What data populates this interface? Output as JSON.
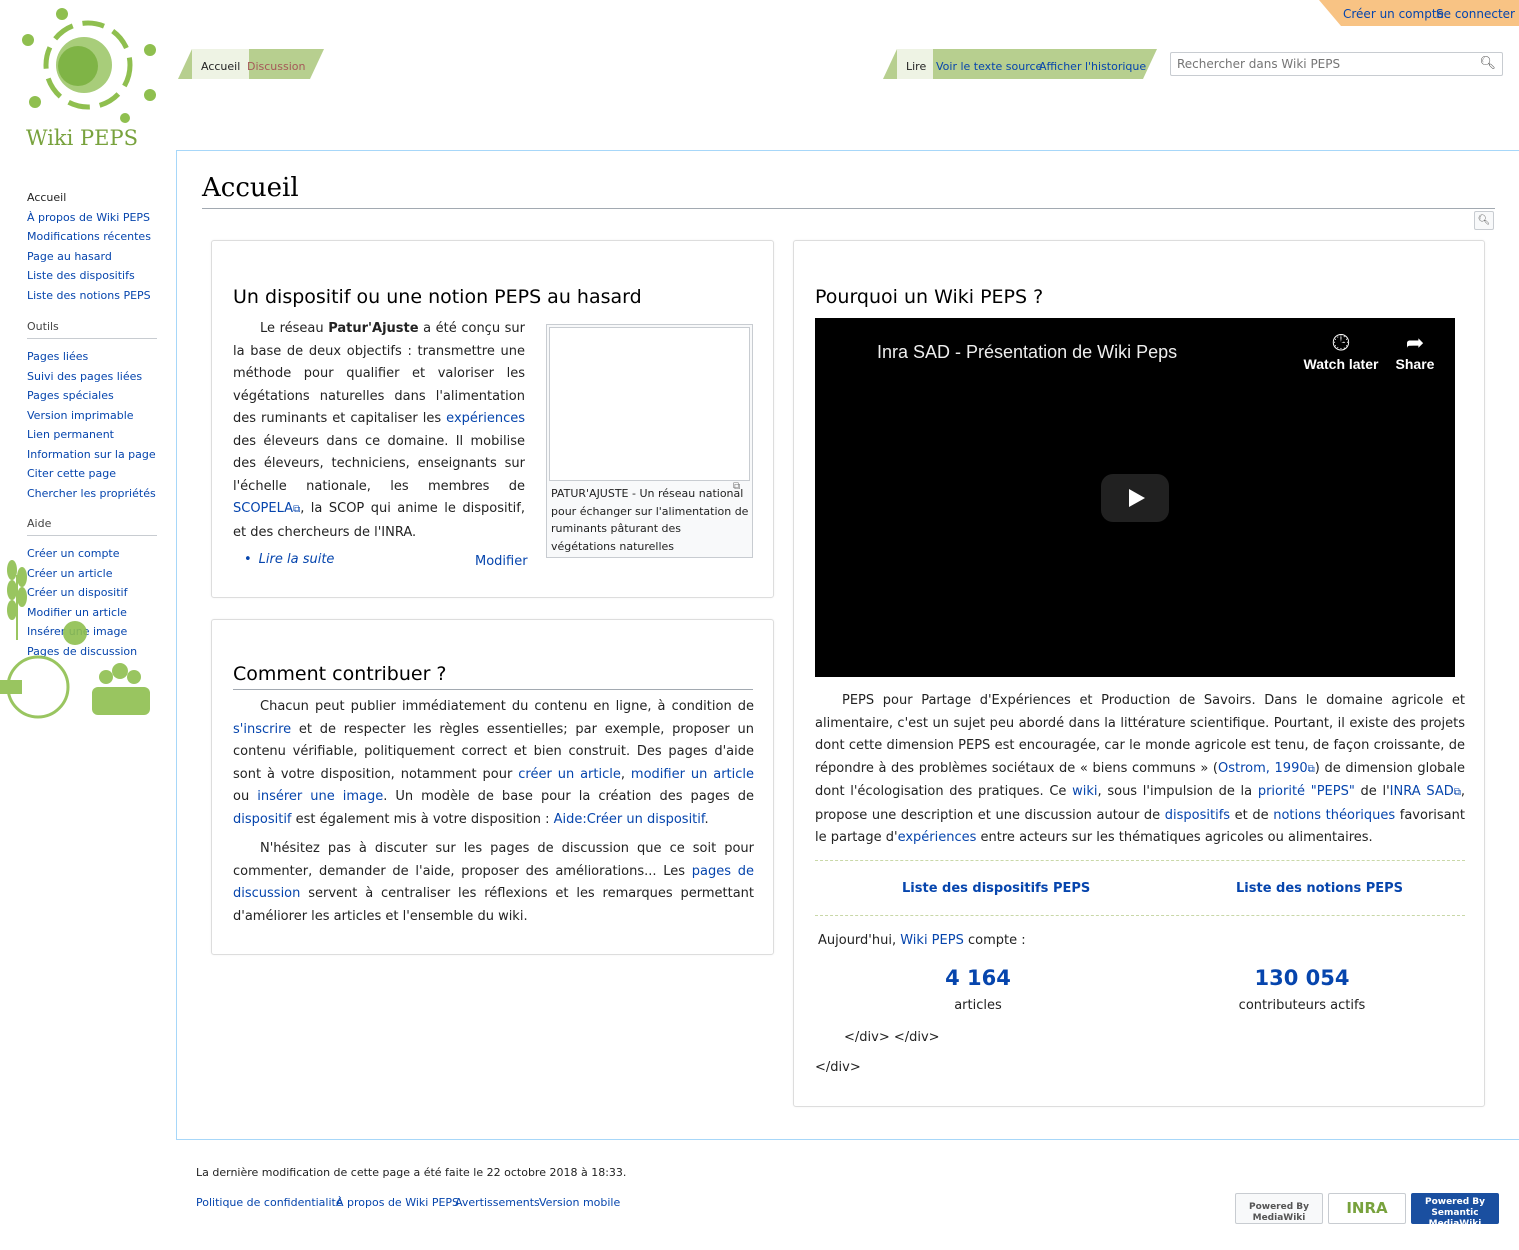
{
  "personal": {
    "create_account": "Créer un compte",
    "login": "Se connecter"
  },
  "logo": {
    "text": "Wiki PEPS"
  },
  "tabs": {
    "left": [
      "Accueil",
      "Discussion"
    ],
    "right": [
      "Lire",
      "Voir le texte source",
      "Afficher l'historique"
    ]
  },
  "search": {
    "placeholder": "Rechercher dans Wiki PEPS"
  },
  "sidebar": {
    "main": [
      "Accueil",
      "À propos de Wiki PEPS",
      "Modifications récentes",
      "Page au hasard",
      "Liste des dispositifs",
      "Liste des notions PEPS"
    ],
    "tools_heading": "Outils",
    "tools": [
      "Pages liées",
      "Suivi des pages liées",
      "Pages spéciales",
      "Version imprimable",
      "Lien permanent",
      "Information sur la page",
      "Citer cette page",
      "Chercher les propriétés"
    ],
    "help_heading": "Aide",
    "help": [
      "Créer un compte",
      "Créer un article",
      "Créer un dispositif",
      "Modifier un article",
      "Insérer une image",
      "Pages de discussion"
    ]
  },
  "page": {
    "title": "Accueil"
  },
  "random_box": {
    "heading": "Un dispositif ou une notion PEPS au hasard",
    "text_1": "Le réseau ",
    "text_bold": "Patur'Ajuste",
    "text_2": " a été conçu sur la base de deux objectifs : transmettre une méthode pour qualifier et valoriser les végétations naturelles dans l'alimentation des ruminants et capitaliser les ",
    "link_experiences": "expériences",
    "text_3": " des éleveurs dans ce domaine. Il mobilise des éleveurs, techniciens, enseignants sur l'échelle nationale, les membres de ",
    "link_scopela": "SCOPELA",
    "text_4": ", la SCOP qui anime le dispositif, et des chercheurs de l'INRA.",
    "read_more": "Lire la suite",
    "edit": "Modifier",
    "thumb_caption": "PATUR'AJUSTE - Un réseau national pour échanger sur l'alimentation de ruminants pâturant des végétations naturelles"
  },
  "contrib_box": {
    "heading": "Comment contribuer ?",
    "p1_a": "Chacun peut publier immédiatement du contenu en ligne, à condition de ",
    "p1_link1": "s'inscrire",
    "p1_b": " et de respecter les règles essentielles; par exemple, proposer un contenu vérifiable, politiquement correct et bien construit. Des pages d'aide sont à votre disposition, notamment pour ",
    "p1_link2": "créer un article",
    "p1_c": ", ",
    "p1_link3": "modifier un article",
    "p1_d": " ou ",
    "p1_link4": "insérer une image",
    "p1_e": ". Un modèle de base pour la création des pages de ",
    "p1_link5": "dispositif",
    "p1_f": " est également mis à votre disposition : ",
    "p1_link6": "Aide:Créer un dispositif",
    "p1_g": ".",
    "p2_a": "N'hésitez pas à discuter sur les pages de discussion que ce soit pour commenter, demander de l'aide, proposer des améliorations... Les ",
    "p2_link": "pages de discussion",
    "p2_b": " servent à centraliser les réflexions et les remarques permettant d'améliorer les articles et l'ensemble du wiki."
  },
  "why_box": {
    "heading": "Pourquoi un Wiki PEPS ?",
    "video": {
      "title": "Inra SAD - Présentation de Wiki Peps",
      "watch_later": "Watch later",
      "share": "Share"
    },
    "t1": "PEPS pour Partage d'Expériences et Production de Savoirs. Dans le domaine agricole et alimentaire, c'est un sujet peu abordé dans la littérature scientifique. Pourtant, il existe des projets dont cette dimension PEPS est encouragée, car le monde agricole est tenu, de façon croissante, de répondre à des problèmes sociétaux de « biens communs » (",
    "l_ostrom": "Ostrom, 1990",
    "t2": ") de dimension globale dont l'écologisation des pratiques. Ce ",
    "l_wiki": "wiki",
    "t3": ", sous l'impulsion de la ",
    "l_priorite": "priorité \"PEPS\"",
    "t4": " de l'",
    "l_inra": "INRA SAD",
    "t5": ", propose une description et une discussion autour de ",
    "l_dispositifs": "dispositifs",
    "t6": " et de ",
    "l_notions": "notions théoriques",
    "t7": " favorisant le partage d'",
    "l_experiences": "expériences",
    "t8": " entre acteurs sur les thématiques agricoles ou alimentaires.",
    "list_dispositifs": "Liste des dispositifs PEPS",
    "list_notions": "Liste des notions PEPS",
    "today_a": "Aujourd'hui, ",
    "today_link": "Wiki PEPS",
    "today_b": " compte :",
    "articles_count": "4 164",
    "articles_label": "articles",
    "contrib_count": "130 054",
    "contrib_label": "contributeurs actifs",
    "raw1": "</div> </div>",
    "raw2": "</div>"
  },
  "footer": {
    "last_modified": "La dernière modification de cette page a été faite le 22 octobre 2018 à 18:33.",
    "links": [
      "Politique de confidentialité",
      "À propos de Wiki PEPS",
      "Avertissements",
      "Version mobile"
    ],
    "badges": [
      "Powered By MediaWiki",
      "INRA",
      "Powered By Semantic MediaWiki"
    ]
  },
  "colors": {
    "accent_green": "#78a23d",
    "tab_green": "#b7cf8f",
    "personal_orange": "#f8c384",
    "link": "#0645ad"
  }
}
